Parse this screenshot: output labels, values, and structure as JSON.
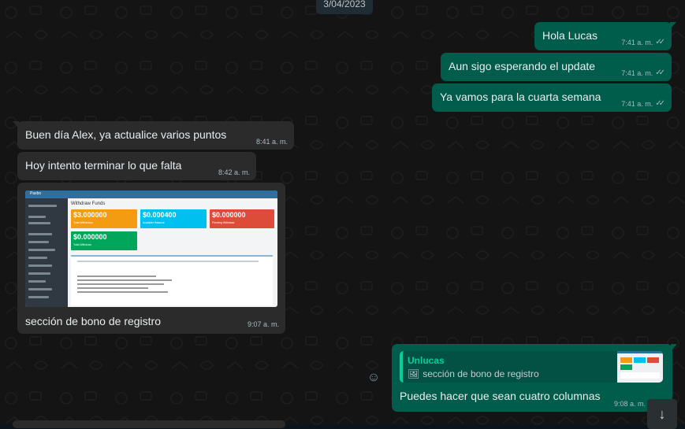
{
  "date_chip": "3/04/2023",
  "messages": [
    {
      "text": "Hola Lucas",
      "time": "7:41 a. m."
    },
    {
      "text": "Aun sigo esperando el update",
      "time": "7:41 a. m."
    },
    {
      "text": "Ya vamos para la cuarta semana",
      "time": "7:41 a. m."
    },
    {
      "text": "Buen día Alex, ya actualice varios puntos",
      "time": "8:41 a. m."
    },
    {
      "text": "Hoy intento terminar lo que falta",
      "time": "8:42 a. m."
    },
    {
      "text": "sección de bono de registro",
      "time": "9:07 a. m."
    },
    {
      "text": "Puedes hacer que sean cuatro columnas",
      "time": "9:08 a. m."
    }
  ],
  "image_preview": {
    "app_name": "Paxbo",
    "page_title": "Withdraw Funds",
    "cards": [
      {
        "amount": "$3.000000",
        "label": "Total Withdrawn",
        "color": "#f39c12"
      },
      {
        "amount": "$0.000400",
        "label": "Available Balance",
        "color": "#00c0ef"
      },
      {
        "amount": "$0.000000",
        "label": "Pending Withdraw",
        "color": "#dd4b39"
      },
      {
        "amount": "$0.000000",
        "label": "Total Withdraw",
        "color": "#00a65a"
      }
    ]
  },
  "reply": {
    "quoted_author": "Unlucas",
    "quoted_text": "sección de bono de registro"
  },
  "colors": {
    "outgoing_bubble": "#005c4b",
    "incoming_bubble": "#2b2b2b",
    "quote_accent": "#06cf9c"
  }
}
